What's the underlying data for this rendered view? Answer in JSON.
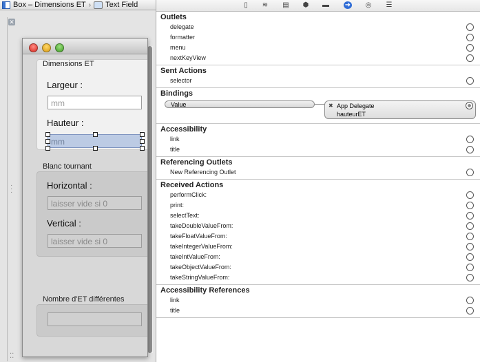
{
  "jumpbar": {
    "item1": "Box – Dimensions ET",
    "separator": "›",
    "item2": "Text Field"
  },
  "canvas": {
    "close_glyph": "✕",
    "window": {
      "box1_title": "Dimensions ET",
      "label_largeur": "Largeur :",
      "field_largeur": "mm",
      "label_hauteur": "Hauteur :",
      "field_hauteur": "mm",
      "box2_title": "Blanc tournant",
      "label_horizontal": "Horizontal :",
      "field_horizontal": "laisser vide si 0",
      "label_vertical": "Vertical :",
      "field_vertical": "laisser vide si 0",
      "box3_title": "Nombre d'ET différentes",
      "field_nombre": ""
    }
  },
  "inspector_toolbar": [
    "file-icon",
    "quick-help-icon",
    "identity-icon",
    "attributes-icon",
    "size-icon",
    "connections-icon",
    "bindings-icon",
    "effects-icon"
  ],
  "inspector": {
    "outlets": {
      "title": "Outlets",
      "items": [
        "delegate",
        "formatter",
        "menu",
        "nextKeyView"
      ]
    },
    "sent_actions": {
      "title": "Sent Actions",
      "items": [
        "selector"
      ]
    },
    "bindings": {
      "title": "Bindings",
      "binding": "Value",
      "target": "App Delegate",
      "key_path": "hauteurET",
      "remove_glyph": "✖"
    },
    "accessibility": {
      "title": "Accessibility",
      "items": [
        "link",
        "title"
      ]
    },
    "referencing_outlets": {
      "title": "Referencing Outlets",
      "items": [
        "New Referencing Outlet"
      ]
    },
    "received_actions": {
      "title": "Received Actions",
      "items": [
        "performClick:",
        "print:",
        "selectText:",
        "takeDoubleValueFrom:",
        "takeFloatValueFrom:",
        "takeIntegerValueFrom:",
        "takeIntValueFrom:",
        "takeObjectValueFrom:",
        "takeStringValueFrom:"
      ]
    },
    "accessibility_references": {
      "title": "Accessibility References",
      "items": [
        "link",
        "title"
      ]
    }
  },
  "colors": {
    "selection": "#bccbe4",
    "active_tab": "#2f6cd6"
  }
}
